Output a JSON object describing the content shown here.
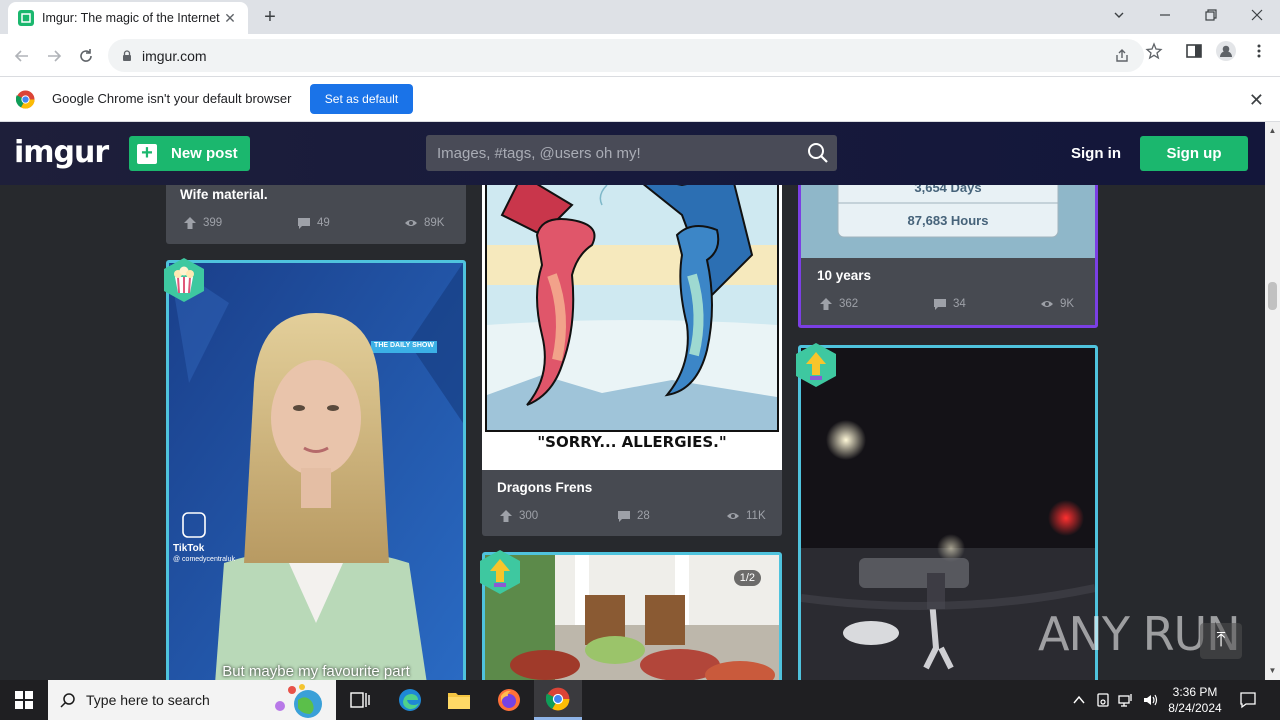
{
  "browser": {
    "tab_title": "Imgur: The magic of the Internet",
    "url": "imgur.com",
    "infobar_text": "Google Chrome isn't your default browser",
    "set_default_label": "Set as default"
  },
  "header": {
    "logo": "imgur",
    "new_post_label": "New post",
    "search_placeholder": "Images, #tags, @users oh my!",
    "sign_in_label": "Sign in",
    "sign_up_label": "Sign up"
  },
  "posts": [
    {
      "title": "Wife material.",
      "upvotes": "399",
      "comments": "49",
      "views": "89K"
    },
    {
      "title": "Dragons Frens",
      "upvotes": "300",
      "comments": "28",
      "views": "11K",
      "caption": "\"SORRY... ALLERGIES.\""
    },
    {
      "title": "10 years",
      "upvotes": "362",
      "comments": "34",
      "views": "9K",
      "days": "3,654 Days",
      "hours": "87,683 Hours"
    },
    {
      "caption": "But maybe my favourite part",
      "show_tag": "THE DAILY SHOW",
      "watermark": "TikTok",
      "handle": "@ comedycentraluk"
    },
    {
      "page_counter": "1/2"
    }
  ],
  "overlay": {
    "watermark": "ANY RUN"
  },
  "taskbar": {
    "search_placeholder": "Type here to search",
    "time": "3:36 PM",
    "date": "8/24/2024"
  },
  "colors": {
    "imgur_green": "#1bb76e",
    "header_bg": "#171a3c",
    "feed_bg": "#27292d",
    "card_bg": "#474a51",
    "border_cyan": "#4fc3dd",
    "border_purple": "#7b3fe4",
    "chrome_blue": "#1a73e8"
  }
}
